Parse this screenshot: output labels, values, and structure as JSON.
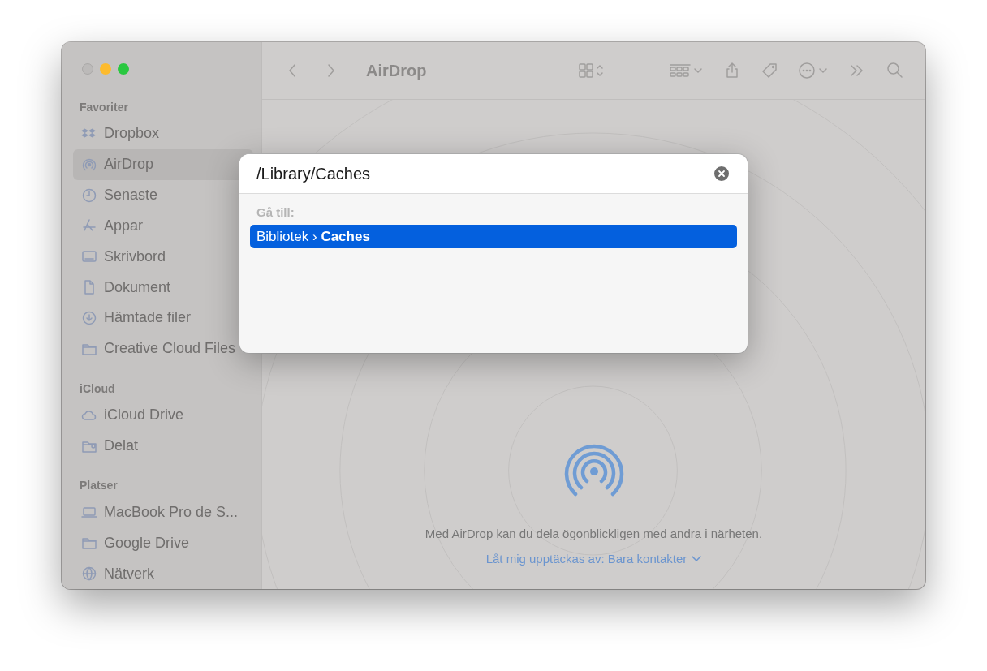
{
  "window": {
    "title": "AirDrop"
  },
  "sidebar": {
    "sections": [
      {
        "heading": "Favoriter",
        "items": [
          {
            "label": "Dropbox",
            "selected": false
          },
          {
            "label": "AirDrop",
            "selected": true
          },
          {
            "label": "Senaste",
            "selected": false
          },
          {
            "label": "Appar",
            "selected": false
          },
          {
            "label": "Skrivbord",
            "selected": false
          },
          {
            "label": "Dokument",
            "selected": false
          },
          {
            "label": "Hämtade filer",
            "selected": false
          },
          {
            "label": "Creative Cloud Files",
            "selected": false
          }
        ]
      },
      {
        "heading": "iCloud",
        "items": [
          {
            "label": "iCloud Drive",
            "selected": false
          },
          {
            "label": "Delat",
            "selected": false
          }
        ]
      },
      {
        "heading": "Platser",
        "items": [
          {
            "label": "MacBook Pro de S...",
            "selected": false
          },
          {
            "label": "Google Drive",
            "selected": false
          },
          {
            "label": "Nätverk",
            "selected": false
          }
        ]
      }
    ]
  },
  "content": {
    "message": "Med AirDrop kan du dela ögonblickligen med andra i närheten.",
    "discovery_link": "Låt mig upptäckas av: Bara kontakter"
  },
  "go_to_dialog": {
    "value": "/Library/Caches",
    "section_label": "Gå till:",
    "results": [
      {
        "text": "Bibliotek › **Caches**",
        "selected": true
      }
    ]
  }
}
